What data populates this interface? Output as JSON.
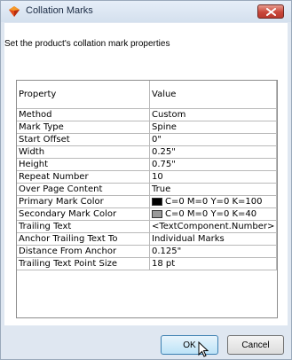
{
  "window": {
    "title": "Collation Marks",
    "icons": {
      "app": "gem-icon",
      "close": "close-icon"
    }
  },
  "instruction": "Set the product's collation mark properties",
  "grid": {
    "headers": {
      "property": "Property",
      "value": "Value"
    },
    "rows": [
      {
        "property": "Method",
        "value": "Custom"
      },
      {
        "property": "Mark Type",
        "value": "Spine"
      },
      {
        "property": "Start Offset",
        "value": "0\""
      },
      {
        "property": "Width",
        "value": "0.25\""
      },
      {
        "property": "Height",
        "value": "0.75\""
      },
      {
        "property": "Repeat Number",
        "value": "10"
      },
      {
        "property": "Over Page Content",
        "value": "True"
      },
      {
        "property": "Primary Mark Color",
        "value": "C=0 M=0 Y=0 K=100",
        "swatch": "#000000"
      },
      {
        "property": "Secondary Mark Color",
        "value": "C=0 M=0 Y=0 K=40",
        "swatch": "#999999"
      },
      {
        "property": "Trailing Text",
        "value": "<TextComponent.Number>"
      },
      {
        "property": "Anchor Trailing Text To",
        "value": "Individual Marks"
      },
      {
        "property": "Distance From Anchor",
        "value": "0.125\""
      },
      {
        "property": "Trailing Text Point Size",
        "value": "18 pt"
      }
    ]
  },
  "buttons": {
    "ok": "OK",
    "cancel": "Cancel"
  },
  "colors": {
    "titlebar": "#dfe7f1",
    "close": "#c9473a",
    "ok_border": "#3c7fb1"
  }
}
